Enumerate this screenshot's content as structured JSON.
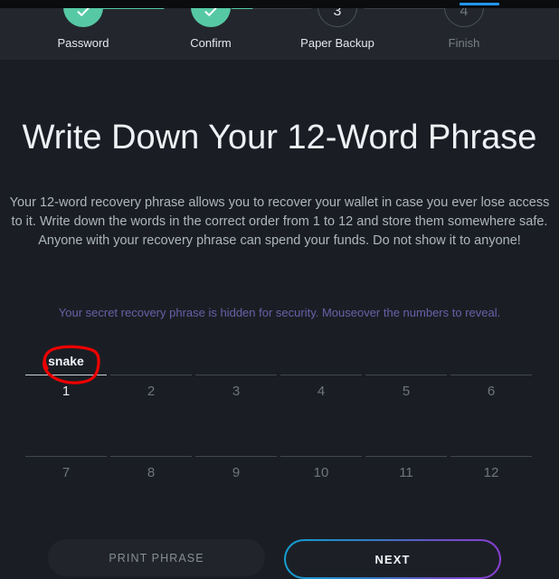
{
  "browser": {
    "loading_bar_color": "#2196f3"
  },
  "stepper": {
    "steps": [
      {
        "label": "Password",
        "state": "done",
        "marker": "check",
        "number": "1"
      },
      {
        "label": "Confirm",
        "state": "done",
        "marker": "check",
        "number": "2"
      },
      {
        "label": "Paper Backup",
        "state": "current",
        "marker": "3",
        "number": "3"
      },
      {
        "label": "Finish",
        "state": "pending",
        "marker": "4",
        "number": "4"
      }
    ],
    "connector_fill_percents": [
      100,
      28,
      0
    ],
    "done_color": "#56c9a4",
    "track_color": "#3a4047"
  },
  "main": {
    "title": "Write Down Your 12-Word Phrase",
    "description": "Your 12-word recovery phrase allows you to recover your wallet in case you ever lose access to it. Write down the words in the correct order from 1 to 12 and store them somewhere safe. Anyone with your recovery phrase can spend your funds. Do not show it to anyone!",
    "hint": "Your secret recovery phrase is hidden for security. Mouseover the numbers to reveal.",
    "hint_color": "#6b5fa8"
  },
  "word_grid": {
    "rows": [
      [
        {
          "index": "1",
          "word": "snake",
          "revealed": true
        },
        {
          "index": "2",
          "word": "",
          "revealed": false
        },
        {
          "index": "3",
          "word": "",
          "revealed": false
        },
        {
          "index": "4",
          "word": "",
          "revealed": false
        },
        {
          "index": "5",
          "word": "",
          "revealed": false
        },
        {
          "index": "6",
          "word": "",
          "revealed": false
        }
      ],
      [
        {
          "index": "7",
          "word": "",
          "revealed": false
        },
        {
          "index": "8",
          "word": "",
          "revealed": false
        },
        {
          "index": "9",
          "word": "",
          "revealed": false
        },
        {
          "index": "10",
          "word": "",
          "revealed": false
        },
        {
          "index": "11",
          "word": "",
          "revealed": false
        },
        {
          "index": "12",
          "word": "",
          "revealed": false
        }
      ]
    ]
  },
  "annotation": {
    "shape": "hand-drawn-ellipse",
    "color": "#ee0000",
    "targets": "snake"
  },
  "footer": {
    "print_label": "PRINT PHRASE",
    "next_label": "NEXT",
    "next_gradient_start": "#159ed2",
    "next_gradient_end": "#8b3fd4"
  }
}
